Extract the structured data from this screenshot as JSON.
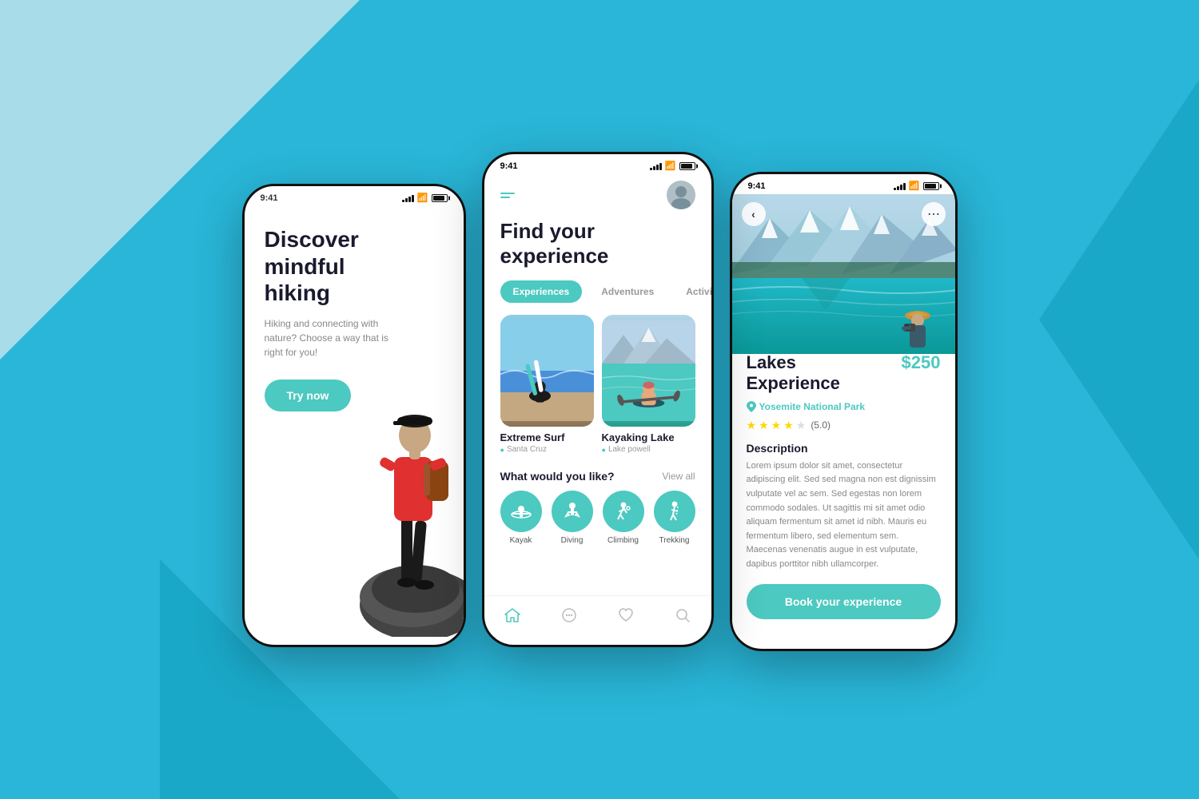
{
  "background": {
    "color": "#29b6d8"
  },
  "phone1": {
    "status_time": "9:41",
    "title_line1": "Discover",
    "title_line2": "mindful hiking",
    "subtitle": "Hiking and connecting with nature? Choose a way that is right for you!",
    "cta_button": "Try now"
  },
  "phone2": {
    "status_time": "9:41",
    "title_line1": "Find your",
    "title_line2": "experience",
    "tabs": [
      {
        "label": "Experiences",
        "active": true
      },
      {
        "label": "Adventures",
        "active": false
      },
      {
        "label": "Activities",
        "active": false
      }
    ],
    "cards": [
      {
        "title": "Extreme Surf",
        "location": "Santa Cruz"
      },
      {
        "title": "Kayaking Lake",
        "location": "Lake powell"
      }
    ],
    "section_title": "What would you like?",
    "view_all": "View all",
    "activities": [
      {
        "label": "Kayak",
        "icon": "🚣"
      },
      {
        "label": "Diving",
        "icon": "🤿"
      },
      {
        "label": "Climbing",
        "icon": "🧗"
      },
      {
        "label": "Trekking",
        "icon": "🥾"
      }
    ],
    "nav_icons": [
      "home",
      "chat",
      "heart",
      "search"
    ]
  },
  "phone3": {
    "status_time": "9:41",
    "title": "Lakes\nExperience",
    "price": "$250",
    "location": "Yosemite National Park",
    "rating": "5.0",
    "stars": 4,
    "description_title": "Description",
    "description": "Lorem ipsum dolor sit amet, consectetur adipiscing elit. Sed sed magna non est dignissim vulputate vel ac sem. Sed egestas non lorem commodo sodales. Ut sagittis mi sit amet odio aliquam fermentum sit amet id nibh. Mauris eu fermentum libero, sed elementum sem. Maecenas venenatis augue in est vulputate, dapibus porttitor nibh ullamcorper.",
    "book_button": "Book your experience"
  }
}
